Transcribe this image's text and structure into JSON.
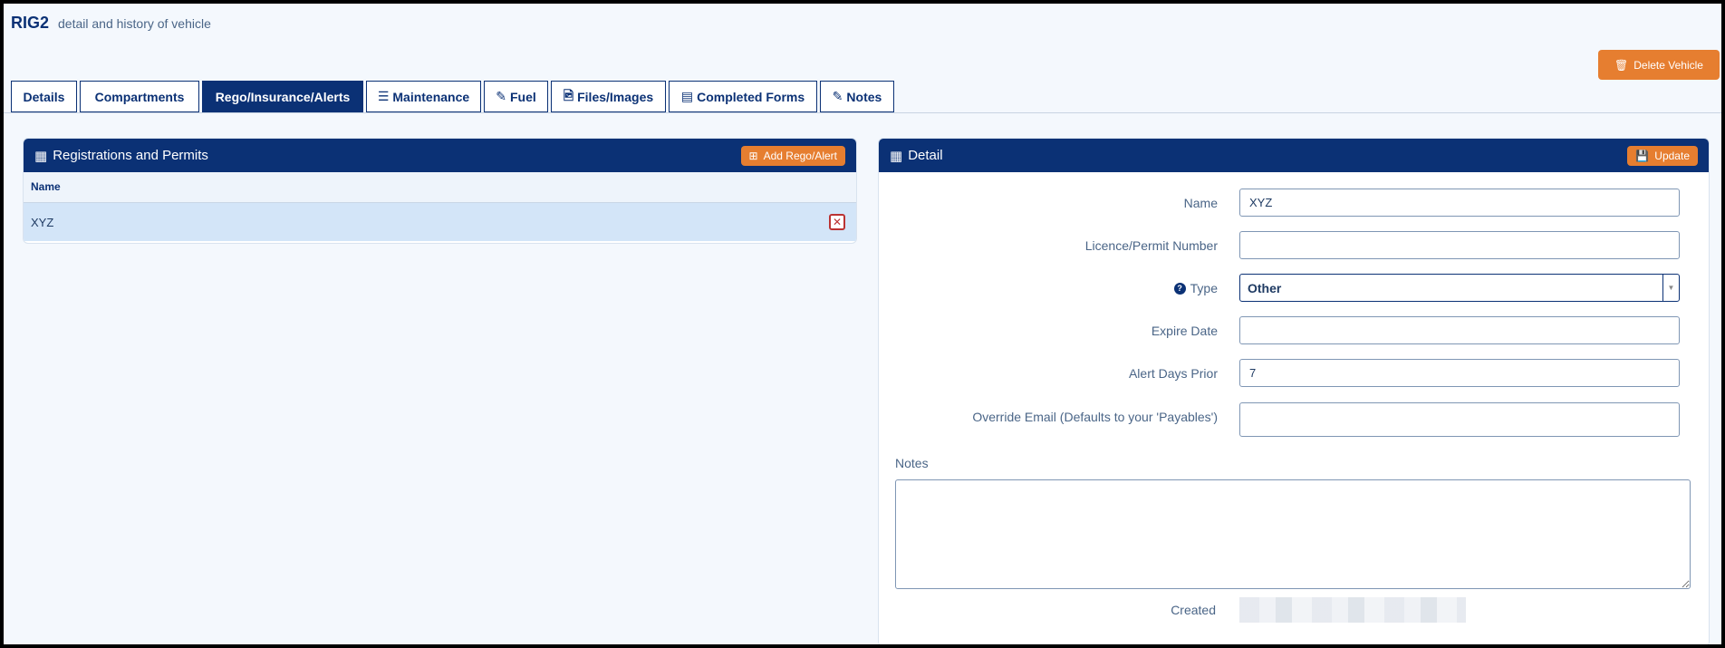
{
  "header": {
    "title": "RIG2",
    "subtitle": "detail and history of vehicle"
  },
  "actions": {
    "delete_label": "Delete Vehicle"
  },
  "tabs": [
    {
      "label": "Details",
      "icon": ""
    },
    {
      "label": "Compartments",
      "icon": ""
    },
    {
      "label": "Rego/Insurance/Alerts",
      "icon": "",
      "active": true
    },
    {
      "label": "Maintenance",
      "icon": "list-icon"
    },
    {
      "label": "Fuel",
      "icon": "pencil-icon"
    },
    {
      "label": "Files/Images",
      "icon": "image-icon"
    },
    {
      "label": "Completed Forms",
      "icon": "forms-icon"
    },
    {
      "label": "Notes",
      "icon": "pencil-icon"
    }
  ],
  "registrations": {
    "title": "Registrations and Permits",
    "add_label": "Add Rego/Alert",
    "column_name": "Name",
    "rows": [
      {
        "name": "XYZ"
      }
    ]
  },
  "detail": {
    "title": "Detail",
    "update_label": "Update",
    "fields": {
      "name": {
        "label": "Name",
        "value": "XYZ"
      },
      "licence": {
        "label": "Licence/Permit Number",
        "value": ""
      },
      "type": {
        "label": "Type",
        "value": "Other"
      },
      "expire": {
        "label": "Expire Date",
        "value": ""
      },
      "alert_days": {
        "label": "Alert Days Prior",
        "value": "7"
      },
      "override_email": {
        "label": "Override Email (Defaults to your 'Payables')",
        "value": ""
      }
    },
    "notes_label": "Notes",
    "created_label": "Created"
  },
  "colors": {
    "primary": "#0b3175",
    "accent": "#e67e30",
    "selected_row": "#d3e5f8"
  }
}
